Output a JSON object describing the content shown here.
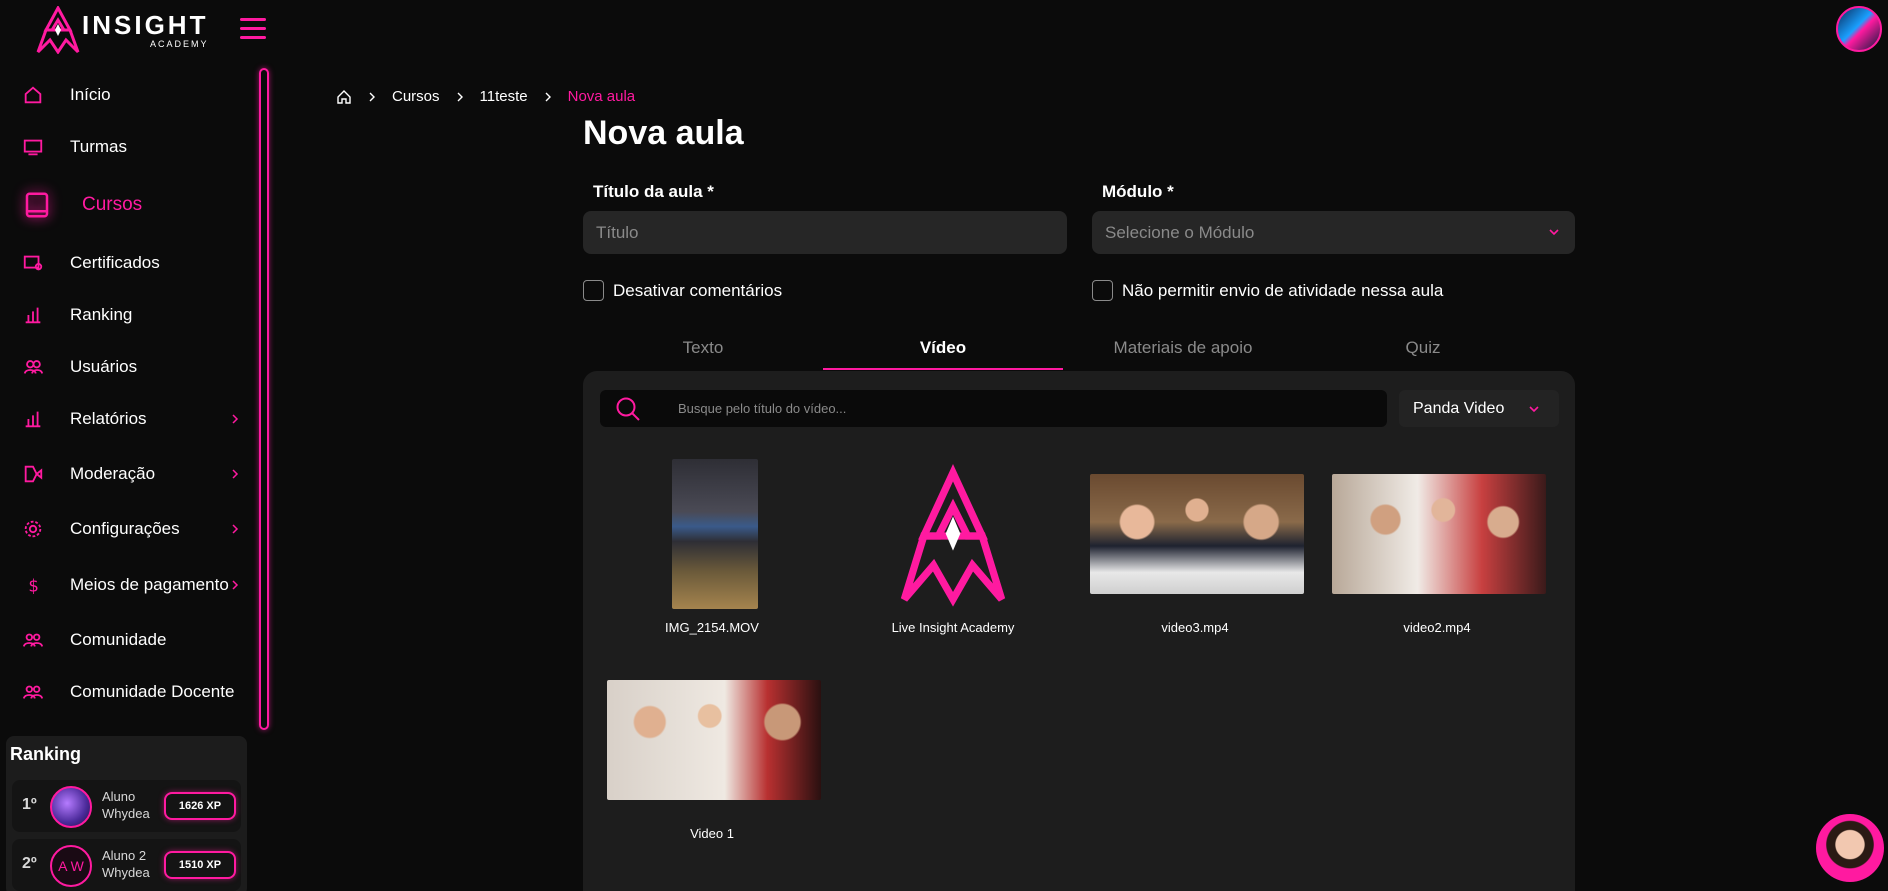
{
  "brand": {
    "logo_big": "INSIGHT",
    "logo_small": "ACADEMY",
    "accent": "#ff1aa0",
    "background": "#0b0b0b"
  },
  "sidebar": {
    "items": [
      {
        "label": "Início",
        "icon": "home-icon",
        "active": false,
        "chevron": false
      },
      {
        "label": "Turmas",
        "icon": "classroom-icon",
        "active": false,
        "chevron": false
      },
      {
        "label": "Cursos",
        "icon": "book-icon",
        "active": true,
        "chevron": false
      },
      {
        "label": "Certificados",
        "icon": "certificate-icon",
        "active": false,
        "chevron": false
      },
      {
        "label": "Ranking",
        "icon": "bar-chart-icon",
        "active": false,
        "chevron": false
      },
      {
        "label": "Usuários",
        "icon": "users-icon",
        "active": false,
        "chevron": false
      },
      {
        "label": "Relatórios",
        "icon": "reports-icon",
        "active": false,
        "chevron": true
      },
      {
        "label": "Moderação",
        "icon": "moderation-icon",
        "active": false,
        "chevron": true
      },
      {
        "label": "Configurações",
        "icon": "gear-icon",
        "active": false,
        "chevron": true
      },
      {
        "label": "Meios de pagamento",
        "icon": "dollar-icon",
        "active": false,
        "chevron": true
      },
      {
        "label": "Comunidade",
        "icon": "community-icon",
        "active": false,
        "chevron": false
      },
      {
        "label": "Comunidade Docente",
        "icon": "community-icon",
        "active": false,
        "chevron": false
      }
    ]
  },
  "ranking": {
    "title": "Ranking",
    "rows": [
      {
        "pos": "1º",
        "name": "Aluno Whydea",
        "initials": "",
        "xp": "1626 XP"
      },
      {
        "pos": "2º",
        "name": "Aluno 2 Whydea",
        "initials": "A W",
        "xp": "1510 XP"
      }
    ]
  },
  "breadcrumb": [
    "Cursos",
    "11teste",
    "Nova aula"
  ],
  "page": {
    "title": "Nova aula",
    "title_label": "Título da aula *",
    "title_placeholder": "Título",
    "module_label": "Módulo *",
    "module_placeholder": "Selecione o Módulo",
    "check_comments": "Desativar comentários",
    "check_activity": "Não permitir envio de atividade nessa aula"
  },
  "tabs": [
    {
      "label": "Texto",
      "active": false
    },
    {
      "label": "Vídeo",
      "active": true
    },
    {
      "label": "Materiais de apoio",
      "active": false
    },
    {
      "label": "Quiz",
      "active": false
    }
  ],
  "video_panel": {
    "search_placeholder": "Busque pelo título do vídeo...",
    "provider": "Panda Video",
    "videos": [
      {
        "title": "IMG_2154.MOV",
        "thumb": "portrait"
      },
      {
        "title": "Live Insight Academy",
        "thumb": "logo"
      },
      {
        "title": "video3.mp4",
        "thumb": "scene"
      },
      {
        "title": "video2.mp4",
        "thumb": "scene2"
      },
      {
        "title": "Video 1",
        "thumb": "scene3"
      }
    ]
  }
}
